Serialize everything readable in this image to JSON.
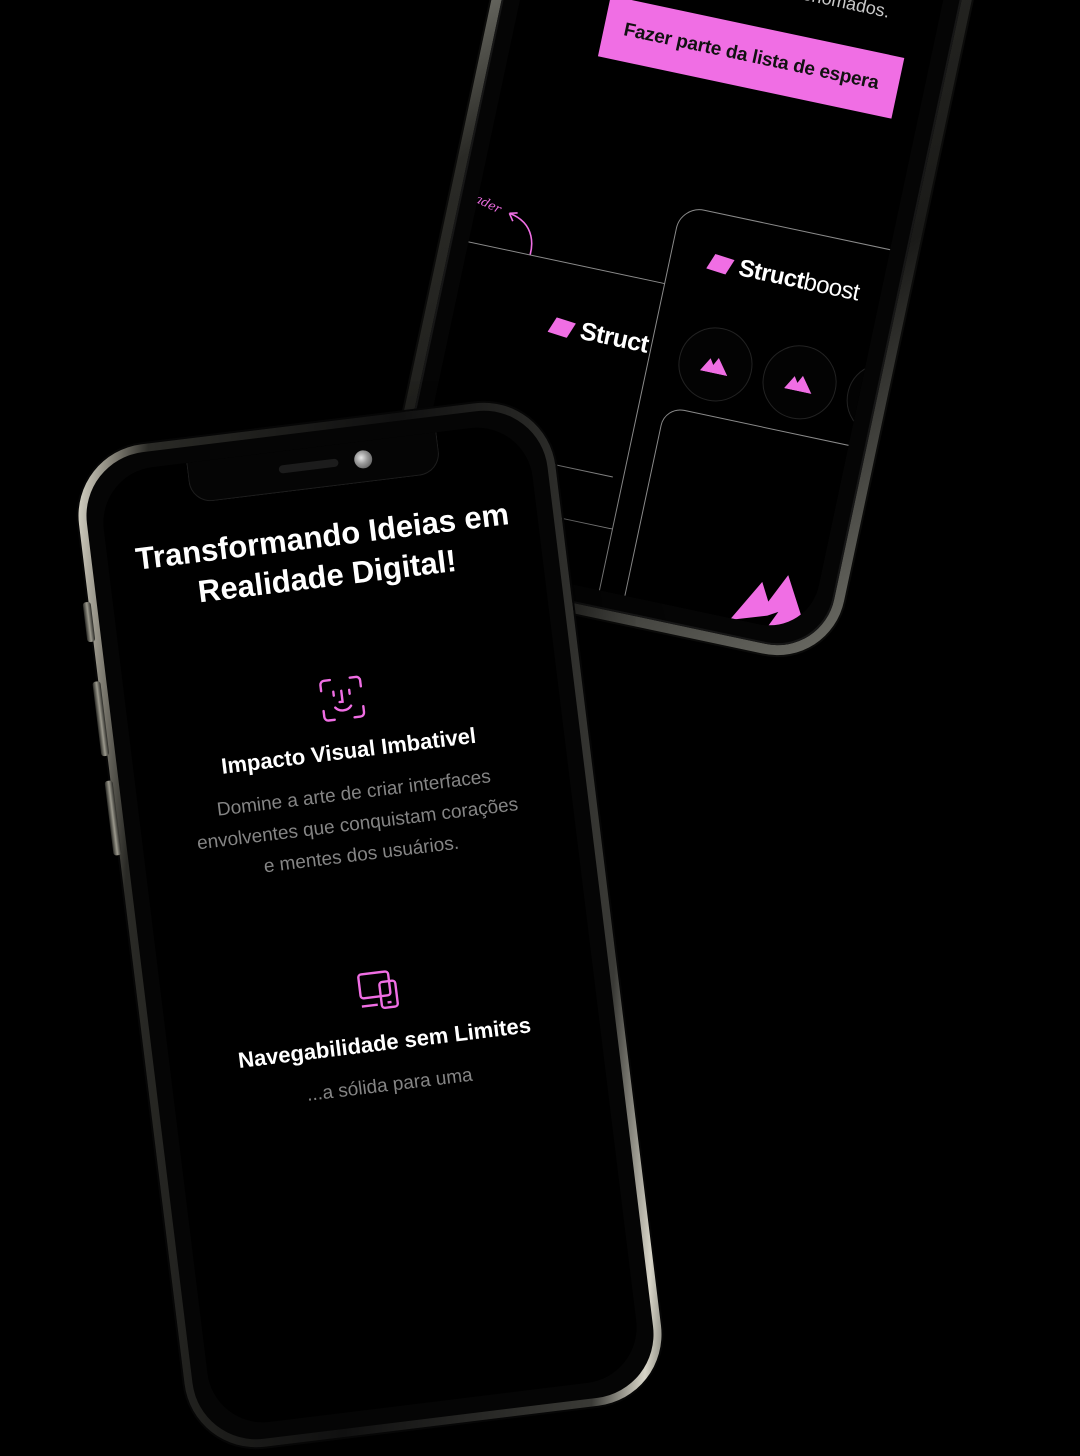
{
  "back_screen": {
    "tagline": "projetos altamente renomados.",
    "cta_label": "Fazer parte da lista de espera",
    "annotation": "Header",
    "logo_a": {
      "bold": "Struct",
      "regular": ""
    },
    "logo_b": {
      "bold": "Struct",
      "regular": "boost"
    }
  },
  "front_screen": {
    "hero_title": "Transformando Ideias em Realidade Digital!",
    "features": [
      {
        "icon": "face-scan-icon",
        "title": "Impacto Visual Imbativel",
        "description": "Domine a arte de criar interfaces envolventes que conquistam corações e mentes dos usuários."
      },
      {
        "icon": "devices-icon",
        "title": "Navegabilidade sem Limites",
        "description": "...a sólida para uma"
      }
    ]
  },
  "colors": {
    "accent": "#f06ee4",
    "background": "#000000",
    "text": "#ffffff",
    "muted_text": "#858585"
  }
}
